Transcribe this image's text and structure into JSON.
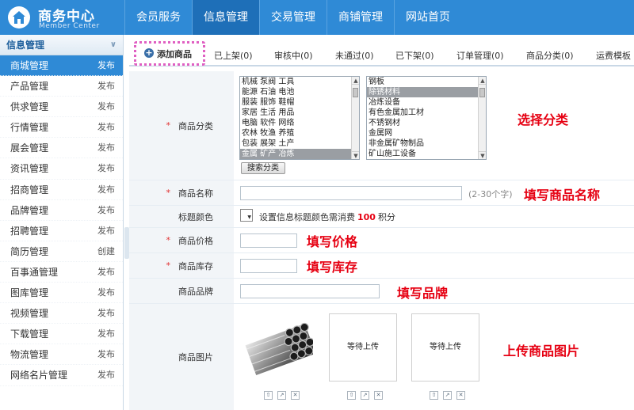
{
  "logo": {
    "title": "商务中心",
    "subtitle": "Member Center"
  },
  "nav": [
    "会员服务",
    "信息管理",
    "交易管理",
    "商铺管理",
    "网站首页"
  ],
  "sidebar": {
    "heading": "信息管理",
    "items": [
      {
        "label": "商城管理",
        "action": "发布"
      },
      {
        "label": "产品管理",
        "action": "发布"
      },
      {
        "label": "供求管理",
        "action": "发布"
      },
      {
        "label": "行情管理",
        "action": "发布"
      },
      {
        "label": "展会管理",
        "action": "发布"
      },
      {
        "label": "资讯管理",
        "action": "发布"
      },
      {
        "label": "招商管理",
        "action": "发布"
      },
      {
        "label": "品牌管理",
        "action": "发布"
      },
      {
        "label": "招聘管理",
        "action": "发布"
      },
      {
        "label": "简历管理",
        "action": "创建"
      },
      {
        "label": "百事通管理",
        "action": "发布"
      },
      {
        "label": "图库管理",
        "action": "发布"
      },
      {
        "label": "视频管理",
        "action": "发布"
      },
      {
        "label": "下载管理",
        "action": "发布"
      },
      {
        "label": "物流管理",
        "action": "发布"
      },
      {
        "label": "网络名片管理",
        "action": "发布"
      }
    ]
  },
  "tabs": {
    "add": "添加商品",
    "items": [
      "已上架(0)",
      "审核中(0)",
      "未通过(0)",
      "已下架(0)",
      "订单管理(0)",
      "商品分类(0)",
      "运费模板"
    ]
  },
  "form": {
    "category_label": "商品分类",
    "category_list1": [
      "机械 泵阀 工具",
      "能源 石油 电池",
      "服装 服饰 鞋帽",
      "家居 生活 用品",
      "电脑 软件 网络",
      "农林 牧渔 养殖",
      "包装 展架 土产",
      "金属 矿产 冶炼"
    ],
    "category_list2": [
      "钢板",
      "除锈材料",
      "冶炼设备",
      "有色金属加工材",
      "不锈钢材",
      "金属网",
      "非金属矿物制品",
      "矿山施工设备"
    ],
    "search_button": "搜索分类",
    "name_label": "商品名称",
    "name_hint": "(2-30个字)",
    "color_label": "标题颜色",
    "color_text_before": "设置信息标题颜色需消费",
    "color_points": "100",
    "color_text_after": "积分",
    "price_label": "商品价格",
    "stock_label": "商品库存",
    "brand_label": "商品品牌",
    "image_label": "商品图片",
    "image_wait": "等待上传"
  },
  "annotations": {
    "category": "选择分类",
    "name": "填写商品名称",
    "price": "填写价格",
    "stock": "填写库存",
    "brand": "填写品牌",
    "images": "上传商品图片"
  }
}
